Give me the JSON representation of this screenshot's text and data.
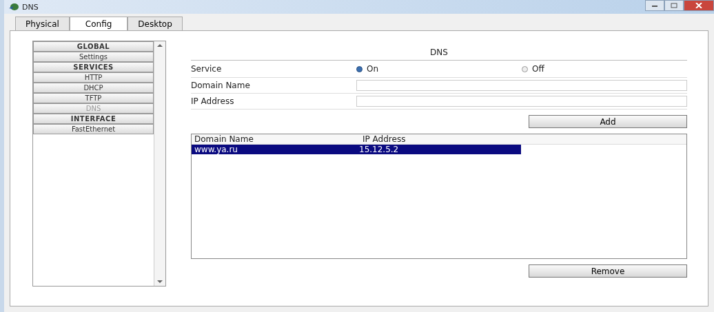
{
  "window": {
    "title": "DNS"
  },
  "tabs": [
    {
      "label": "Physical",
      "selected": false
    },
    {
      "label": "Config",
      "selected": true
    },
    {
      "label": "Desktop",
      "selected": false
    }
  ],
  "sidebar": {
    "items": [
      {
        "label": "GLOBAL",
        "kind": "header",
        "selected": false
      },
      {
        "label": "Settings",
        "kind": "item",
        "selected": false
      },
      {
        "label": "SERVICES",
        "kind": "header",
        "selected": false
      },
      {
        "label": "HTTP",
        "kind": "item",
        "selected": false
      },
      {
        "label": "DHCP",
        "kind": "item",
        "selected": false
      },
      {
        "label": "TFTP",
        "kind": "item",
        "selected": false
      },
      {
        "label": "DNS",
        "kind": "item",
        "selected": true
      },
      {
        "label": "INTERFACE",
        "kind": "header",
        "selected": false
      },
      {
        "label": "FastEthernet",
        "kind": "item",
        "selected": false
      }
    ]
  },
  "panel": {
    "title": "DNS",
    "service_label": "Service",
    "service_options": [
      {
        "label": "On",
        "selected": true
      },
      {
        "label": "Off",
        "selected": false
      }
    ],
    "domain_label": "Domain Name",
    "ip_label": "IP Address",
    "add_button": "Add",
    "table": {
      "columns": [
        "Domain Name",
        "IP Address"
      ],
      "rows": [
        {
          "cells": [
            "www.ya.ru",
            "15.12.5.2"
          ],
          "selected": true
        }
      ]
    },
    "remove_button": "Remove"
  }
}
